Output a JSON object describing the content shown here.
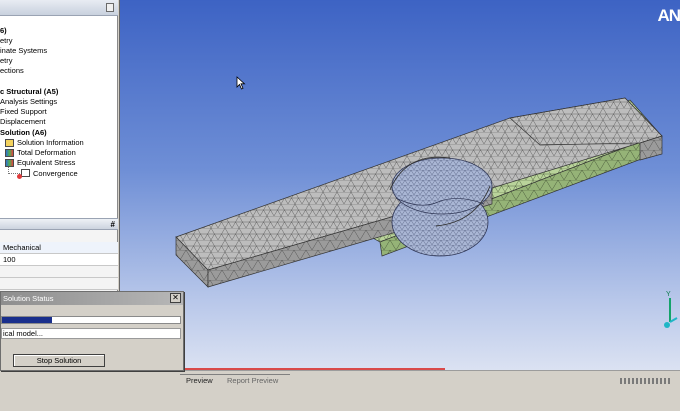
{
  "outline": {
    "items": [
      {
        "label": "6)"
      },
      {
        "label": "etry"
      },
      {
        "label": "inate Systems"
      },
      {
        "label": "etry"
      },
      {
        "label": "ections"
      },
      {
        "label": "c Structural (A5)"
      },
      {
        "label": "Analysis Settings"
      },
      {
        "label": "Fixed Support"
      },
      {
        "label": "Displacement"
      },
      {
        "label": "Solution (A6)"
      },
      {
        "label": "Solution Information"
      },
      {
        "label": "Total Deformation"
      },
      {
        "label": "Equivalent Stress"
      },
      {
        "label": "Convergence"
      }
    ]
  },
  "details": {
    "rows": [
      {
        "value": "Mechanical"
      },
      {
        "value": "100"
      }
    ]
  },
  "viewport": {
    "brand": "AN"
  },
  "dialog": {
    "title": "Solution Status",
    "status": "ical model...",
    "progress": 0.28,
    "stop_label": "Stop Solution"
  },
  "tabs": {
    "preview": "Preview",
    "report": "Report Preview"
  },
  "colors": {
    "mesh_gray": "#bdbdbd",
    "mesh_green": "#b9d39a",
    "pin_blue": "#a9b6d4",
    "progress": "#1a2f8c"
  }
}
